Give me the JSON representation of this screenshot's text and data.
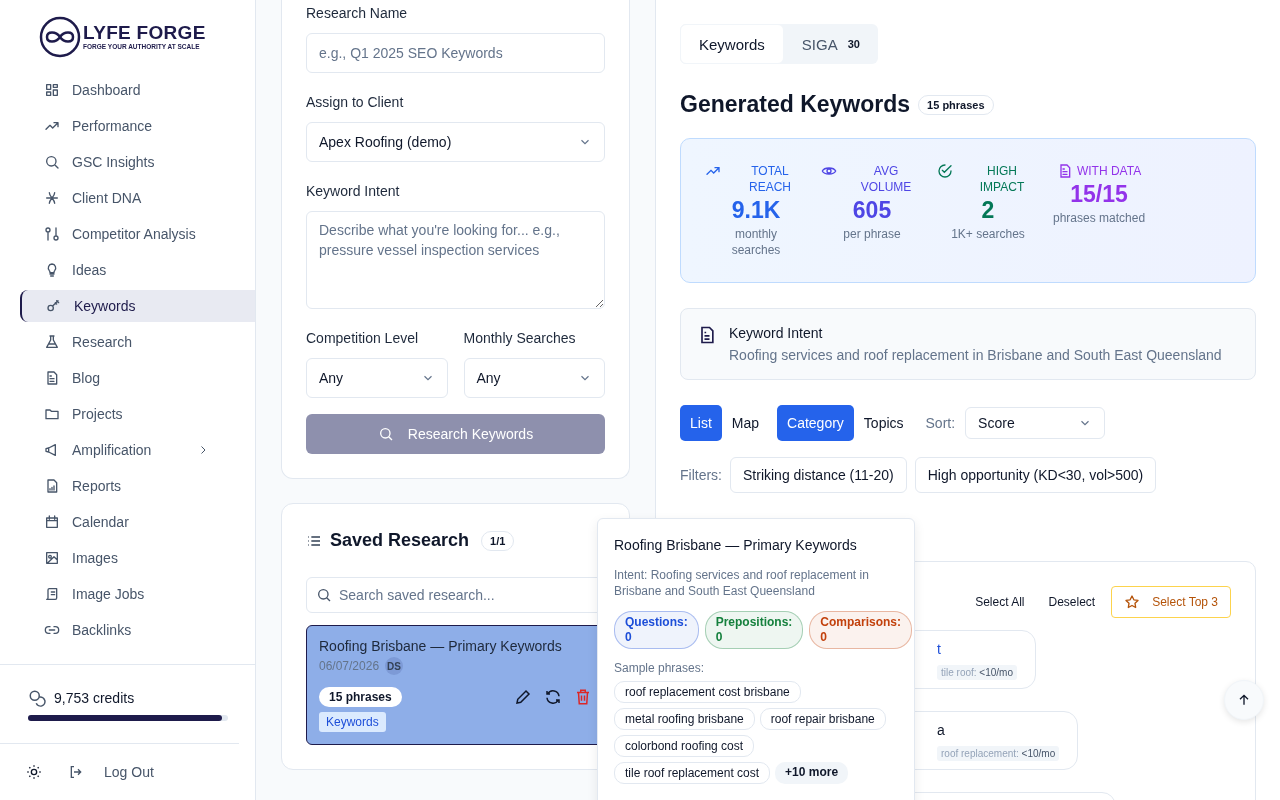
{
  "brand": {
    "name": "LYFE FORGE",
    "tagline": "FORGE YOUR AUTHORITY AT SCALE"
  },
  "sidebar": {
    "items": [
      {
        "label": "Dashboard",
        "selected": false,
        "has_submenu": false
      },
      {
        "label": "Performance",
        "selected": false,
        "has_submenu": false
      },
      {
        "label": "GSC Insights",
        "selected": false,
        "has_submenu": false
      },
      {
        "label": "Client DNA",
        "selected": false,
        "has_submenu": false
      },
      {
        "label": "Competitor Analysis",
        "selected": false,
        "has_submenu": false
      },
      {
        "label": "Ideas",
        "selected": false,
        "has_submenu": false
      },
      {
        "label": "Keywords",
        "selected": true,
        "has_submenu": false
      },
      {
        "label": "Research",
        "selected": false,
        "has_submenu": false
      },
      {
        "label": "Blog",
        "selected": false,
        "has_submenu": false
      },
      {
        "label": "Projects",
        "selected": false,
        "has_submenu": false
      },
      {
        "label": "Amplification",
        "selected": false,
        "has_submenu": true
      },
      {
        "label": "Reports",
        "selected": false,
        "has_submenu": false
      },
      {
        "label": "Calendar",
        "selected": false,
        "has_submenu": false
      },
      {
        "label": "Images",
        "selected": false,
        "has_submenu": false
      },
      {
        "label": "Image Jobs",
        "selected": false,
        "has_submenu": false
      },
      {
        "label": "Backlinks",
        "selected": false,
        "has_submenu": false
      }
    ],
    "credits": {
      "label": "9,753 credits",
      "level": 0.97
    },
    "logout": "Log Out"
  },
  "form": {
    "name": {
      "label": "Research Name",
      "placeholder": "e.g., Q1 2025 SEO Keywords"
    },
    "client": {
      "label": "Assign to Client",
      "value": "Apex Roofing (demo)"
    },
    "intent": {
      "label": "Keyword Intent",
      "placeholder": "Describe what you're looking for... e.g., pressure vessel inspection services"
    },
    "competition": {
      "label": "Competition Level",
      "value": "Any"
    },
    "searches": {
      "label": "Monthly Searches",
      "value": "Any"
    },
    "submit": {
      "label": "Research Keywords",
      "disabled": true
    }
  },
  "saved_research": {
    "title": "Saved Research",
    "count": "1/1",
    "search_placeholder": "Search saved research...",
    "items": [
      {
        "title": "Roofing Brisbane — Primary Keywords",
        "date": "06/07/2026",
        "initials": "DS",
        "phrases": "15 phrases",
        "tag": "Keywords",
        "selected": true
      }
    ]
  },
  "tabs": [
    {
      "label": "Keywords",
      "selected": true
    },
    {
      "label": "SIGA",
      "count": "30",
      "selected": false
    }
  ],
  "heading": {
    "title": "Generated Keywords",
    "badge": "15 phrases"
  },
  "stats": [
    {
      "label": "TOTAL REACH",
      "value": "9.1K",
      "sub": "monthly searches",
      "color": "#2563eb"
    },
    {
      "label": "AVG VOLUME",
      "value": "605",
      "sub": "per phrase",
      "color": "#4f46e5"
    },
    {
      "label": "HIGH IMPACT",
      "value": "2",
      "sub": "1K+ searches",
      "color": "#047857"
    },
    {
      "label": "WITH DATA",
      "value": "15/15",
      "sub": "phrases matched",
      "color": "#9333ea"
    }
  ],
  "intent_card": {
    "title": "Keyword Intent",
    "text": "Roofing services and roof replacement in Brisbane and South East Queensland"
  },
  "views": [
    {
      "label": "List",
      "selected": true
    },
    {
      "label": "Map",
      "selected": false
    }
  ],
  "groupings": [
    {
      "label": "Category",
      "selected": true
    },
    {
      "label": "Topics",
      "selected": false
    }
  ],
  "sort": {
    "label": "Sort:",
    "value": "Score"
  },
  "filters": {
    "label": "Filters:",
    "chips": [
      "Striking distance (11-20)",
      "High opportunity (KD<30, vol>500)"
    ]
  },
  "results": {
    "actions": [
      "Select All",
      "Deselect"
    ],
    "top_button": "Select Top 3",
    "cards": [
      {
        "title": "t",
        "meta_label": "tile roof:",
        "meta_value": "<10/mo"
      },
      {
        "title": "a",
        "meta_label": "roof replacement:",
        "meta_value": "<10/mo"
      }
    ]
  },
  "popover": {
    "title": "Roofing Brisbane — Primary Keywords",
    "intent": "Intent: Roofing services and roof replacement in Brisbane and South East Queensland",
    "counts": [
      {
        "label": "Questions:",
        "value": "0",
        "color": "#1d4ed8"
      },
      {
        "label": "Prepositions:",
        "value": "0",
        "color": "#15803d"
      },
      {
        "label": "Comparisons:",
        "value": "0",
        "color": "#c2410c"
      }
    ],
    "sample_label": "Sample phrases:",
    "phrases": [
      "roof replacement cost brisbane",
      "metal roofing brisbane",
      "roof repair brisbane",
      "colorbond roofing cost",
      "tile roof replacement cost"
    ],
    "more": "+10 more"
  }
}
